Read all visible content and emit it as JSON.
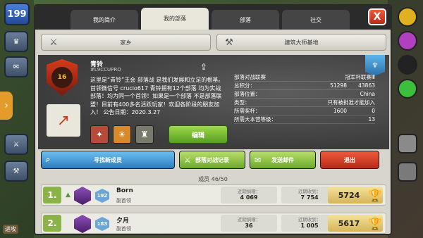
{
  "hud": {
    "level": "199",
    "corner_label": "进攻"
  },
  "tabs": [
    {
      "label": "我的简介"
    },
    {
      "label": "我的部落"
    },
    {
      "label": "部落"
    },
    {
      "label": "社交"
    }
  ],
  "close_label": "X",
  "subnav": {
    "clan_games": "家乡",
    "builder_base": "建筑大师基地"
  },
  "clan": {
    "name": "青铃",
    "tag": "#L9CCUPRO",
    "badge_level": "16",
    "description": "这里是“青铃”王会 部落战 是我们发展和立足的根基。首领微信号 crucio617 青铃拥有12个部落 均为实战部落！均为同一个首领！如果是一个部落 不是部落联盟！目前有400多名活跃玩家！欢迎各阶段的朋友加入！ 公告日期：2020.3.27",
    "edit_label": "编辑"
  },
  "stats": {
    "war_league_label": "部落对战联赛",
    "war_league_value": "冠军杯联赛Ⅲ",
    "points_label": "总积分：",
    "points_value": "51298",
    "points_value2": "43863",
    "location_label": "部落位置：",
    "location_value": "China",
    "type_label": "类型：",
    "type_value": "只有被批准才能加入",
    "required_trophies_label": "所需奖杯：",
    "required_trophies_value": "1600",
    "required_trophies_value2": "0",
    "required_th_label": "所需大本营等级：",
    "required_th_value": "13"
  },
  "actions": {
    "find_members": "寻找新成员",
    "war_log": "部落对战记录",
    "send_mail": "发送邮件",
    "leave": "退出"
  },
  "members_title": "成员 46/50",
  "members": [
    {
      "rank": "1.",
      "level": "192",
      "name": "Born",
      "role": "副首领",
      "donated_label": "近期捐赠：",
      "donated": "4 069",
      "received_label": "近期收到：",
      "received": "7 754",
      "trophies": "5724"
    },
    {
      "rank": "2.",
      "level": "183",
      "name": "夕月",
      "role": "副首领",
      "donated_label": "近期捐赠：",
      "donated": "36",
      "received_label": "近期收到：",
      "received": "1 005",
      "trophies": "5617"
    }
  ]
}
